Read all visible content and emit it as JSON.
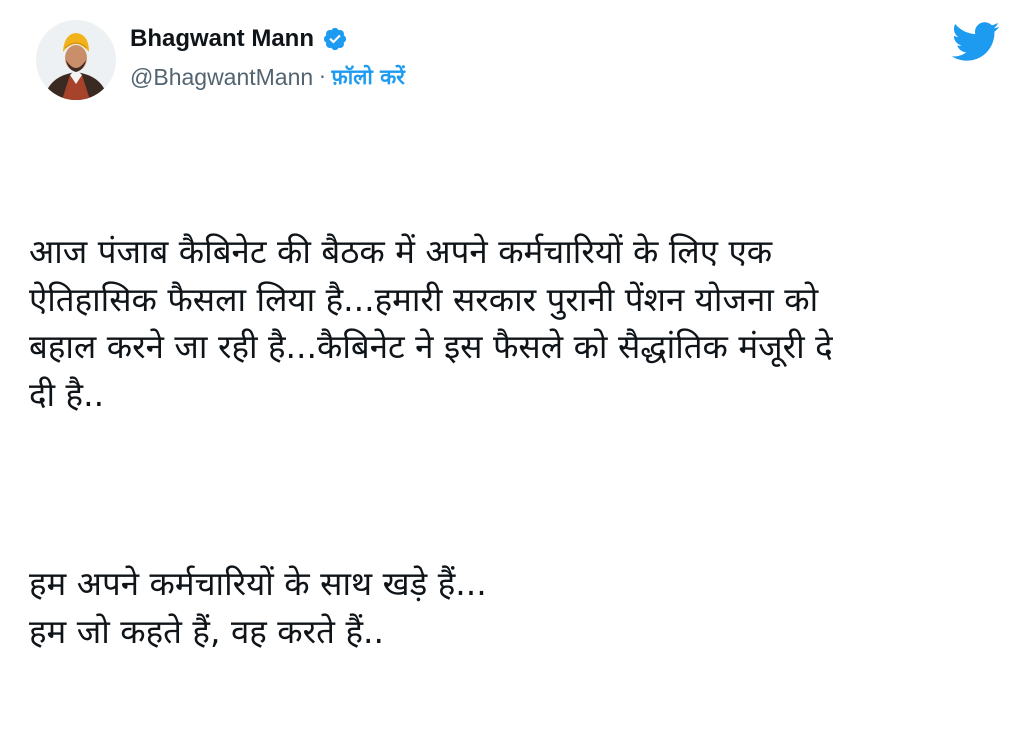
{
  "author": {
    "name": "Bhagwant Mann",
    "handle": "@BhagwantMann",
    "separator": "·",
    "follow_label": "फ़ॉलो करें",
    "verified": true
  },
  "colors": {
    "accent": "#1d9bf0",
    "text": "#0f1419",
    "muted": "#536471"
  },
  "icons": {
    "verified": "verified-badge-icon",
    "brand": "twitter-bird-icon"
  },
  "tweet": {
    "paragraph1": "आज पंजाब कैबिनेट की बैठक में अपने कर्मचारियों के लिए एक\nऐतिहासिक फैसला लिया है...हमारी सरकार पुरानी पेंशन योजना को\nबहाल करने जा रही है...कैबिनेट ने इस फैसले को सैद्धांतिक मंजूरी दे\nदी है..",
    "paragraph2": "हम अपने कर्मचारियों के साथ खड़े हैं...\nहम जो कहते हैं, वह करते हैं.."
  }
}
